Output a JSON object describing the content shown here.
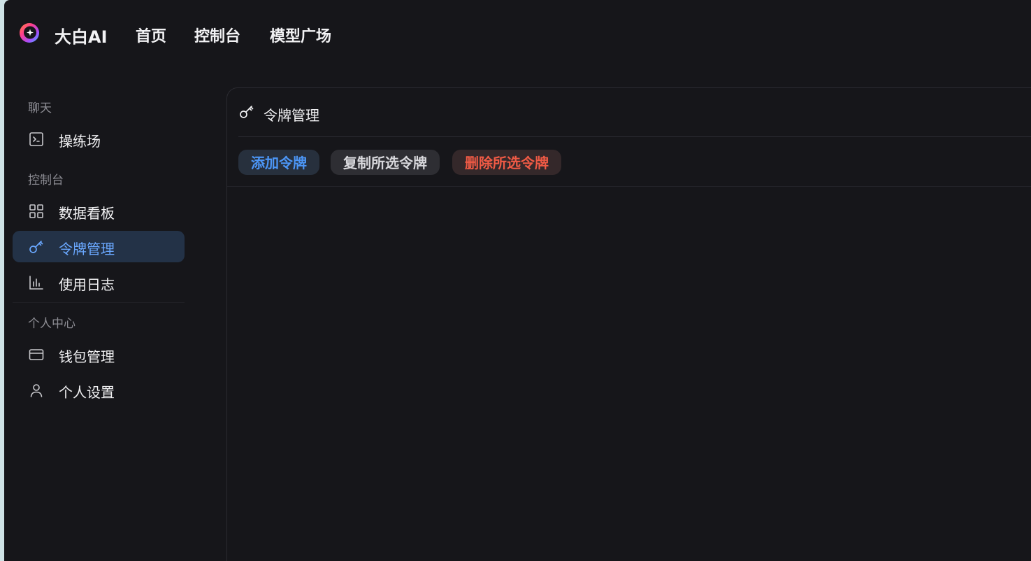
{
  "header": {
    "brand": "大白AI",
    "nav": [
      "首页",
      "控制台",
      "模型广场"
    ]
  },
  "sidebar": {
    "sections": [
      {
        "title": "聊天",
        "items": [
          {
            "label": "操练场",
            "icon": "terminal-icon"
          }
        ]
      },
      {
        "title": "控制台",
        "items": [
          {
            "label": "数据看板",
            "icon": "dashboard-grid-icon"
          },
          {
            "label": "令牌管理",
            "icon": "key-icon",
            "active": true
          },
          {
            "label": "使用日志",
            "icon": "bar-chart-icon"
          }
        ]
      },
      {
        "title": "个人中心",
        "items": [
          {
            "label": "钱包管理",
            "icon": "credit-card-icon"
          },
          {
            "label": "个人设置",
            "icon": "user-icon"
          }
        ]
      }
    ]
  },
  "main": {
    "title": "令牌管理",
    "title_icon": "key-icon",
    "buttons": {
      "add": "添加令牌",
      "copy": "复制所选令牌",
      "delete": "删除所选令牌"
    }
  },
  "colors": {
    "background": "#16161a",
    "active_item_bg": "#233247",
    "accent_blue": "#4c96f6",
    "danger_red": "#ef5a45"
  }
}
